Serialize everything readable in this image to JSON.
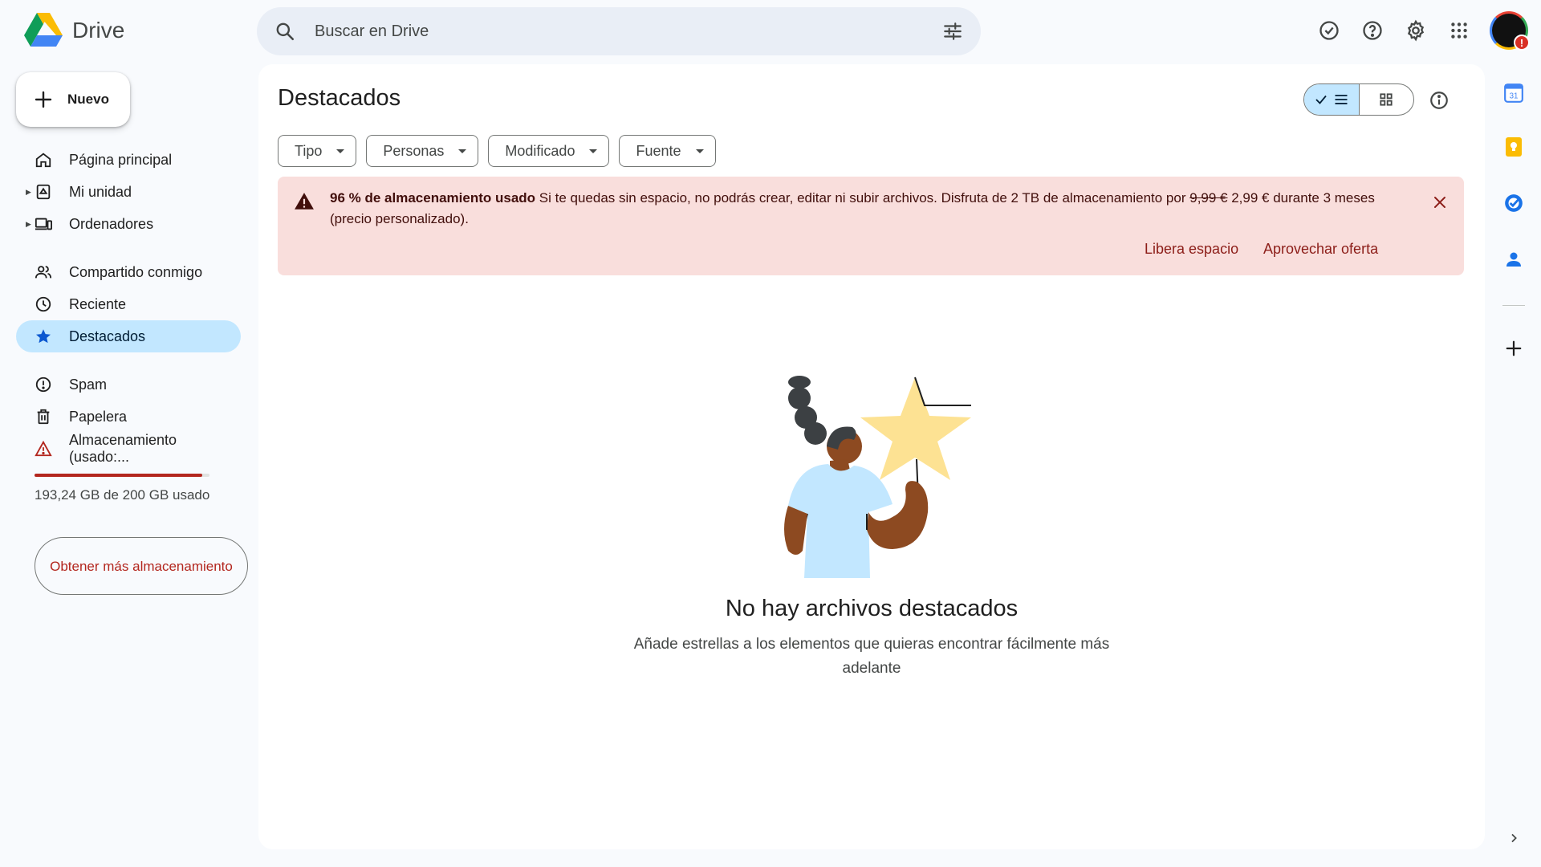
{
  "app": {
    "name": "Drive"
  },
  "search": {
    "placeholder": "Buscar en Drive"
  },
  "new_button": {
    "label": "Nuevo"
  },
  "nav": {
    "items": [
      {
        "label": "Página principal",
        "icon": "home-icon"
      },
      {
        "label": "Mi unidad",
        "icon": "drive-icon"
      },
      {
        "label": "Ordenadores",
        "icon": "computer-icon"
      },
      {
        "label": "Compartido conmigo",
        "icon": "people-icon"
      },
      {
        "label": "Reciente",
        "icon": "clock-icon"
      },
      {
        "label": "Destacados",
        "icon": "star-icon",
        "active": true
      },
      {
        "label": "Spam",
        "icon": "spam-icon"
      },
      {
        "label": "Papelera",
        "icon": "trash-icon"
      },
      {
        "label": "Almacenamiento (usado:...",
        "icon": "warning-icon"
      }
    ]
  },
  "storage": {
    "used_fraction": 0.96,
    "text": "193,24 GB de 200 GB usado",
    "button": "Obtener más almacenamiento",
    "bar_color": "#b3261e"
  },
  "main": {
    "title": "Destacados",
    "filters": [
      "Tipo",
      "Personas",
      "Modificado",
      "Fuente"
    ]
  },
  "banner": {
    "bold": "96 % de almacenamiento usado",
    "text_before": " Si te quedas sin espacio, no podrás crear, editar ni subir archivos. Disfruta de 2 TB de almacenamiento por ",
    "old_price": "9,99 €",
    "text_after": " 2,99 € durante 3 meses (precio personalizado).",
    "action_free": "Libera espacio",
    "action_offer": "Aprovechar oferta",
    "bg_color": "#f9dedc"
  },
  "empty": {
    "title": "No hay archivos destacados",
    "subtitle": "Añade estrellas a los elementos que quieras encontrar fácilmente más adelante"
  },
  "colors": {
    "accent": "#c2e7ff",
    "danger": "#b3261e"
  }
}
